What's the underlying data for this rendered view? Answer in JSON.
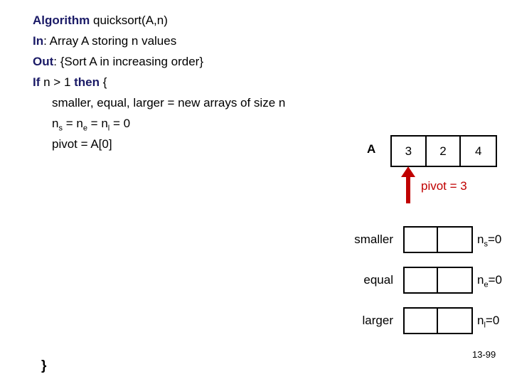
{
  "pseudocode": {
    "lines": [
      {
        "keyword": "Algorithm",
        "rest": " quicksort(A,n)",
        "indent": false
      },
      {
        "keyword": "In",
        "rest": ": Array A storing n values",
        "indent": false
      },
      {
        "keyword": "Out",
        "rest": ": {Sort A in increasing order}",
        "indent": false
      },
      {
        "keyword": "If",
        "rest": " n > 1 ",
        "keyword2": "then",
        "rest2": " {",
        "indent": false
      },
      {
        "keyword": "",
        "rest": "smaller, equal, larger = new arrays of size n",
        "indent": true
      },
      {
        "keyword": "",
        "rest": "pivot = A[0]",
        "indent": true
      }
    ],
    "counters_line": {
      "n1": "n",
      "sub1": "s",
      "eq1": " = ",
      "n2": "n",
      "sub2": "e",
      "eq2": " = ",
      "n3": "n",
      "sub3": "l",
      "eq3": " = 0"
    },
    "closing_brace": "}"
  },
  "array_a": {
    "label": "A",
    "values": [
      "3",
      "2",
      "4"
    ]
  },
  "pivot": {
    "text": "pivot = 3",
    "color": "#c00000",
    "points_to_index": 0
  },
  "result_arrays": [
    {
      "label": "smaller",
      "cells": [
        "",
        ""
      ],
      "counter": {
        "name": "n",
        "subscript": "s",
        "value": "=0"
      }
    },
    {
      "label": "equal",
      "cells": [
        "",
        ""
      ],
      "counter": {
        "name": "n",
        "subscript": "e",
        "value": "=0"
      }
    },
    {
      "label": "larger",
      "cells": [
        "",
        ""
      ],
      "counter": {
        "name": "n",
        "subscript": "l",
        "value": "=0"
      }
    }
  ],
  "footer": {
    "page_number": "13-99"
  },
  "colors": {
    "keyword": "#1a1a66",
    "accent_red": "#c00000",
    "ink": "#000000",
    "background": "#ffffff"
  }
}
